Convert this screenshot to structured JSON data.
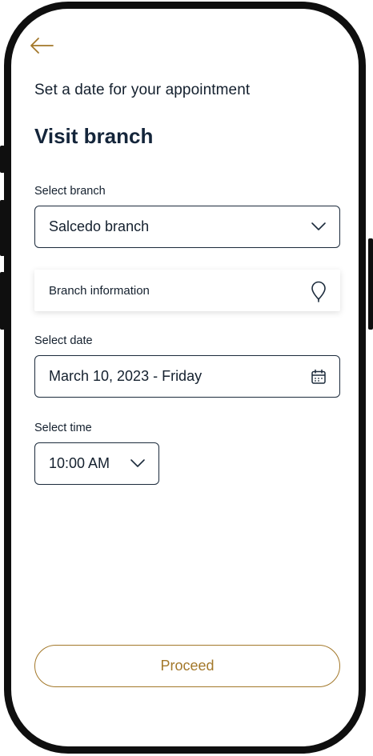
{
  "header": {
    "back_icon": "arrow-left-icon",
    "subtitle": "Set a date for your appointment",
    "title": "Visit branch"
  },
  "branch": {
    "label": "Select branch",
    "value": "Salcedo branch",
    "icon": "chevron-down-icon"
  },
  "branch_info": {
    "label": "Branch information",
    "icon": "map-pin-icon"
  },
  "date": {
    "label": "Select date",
    "value": "March 10, 2023 - Friday",
    "icon": "calendar-icon"
  },
  "time": {
    "label": "Select time",
    "value": "10:00 AM",
    "icon": "chevron-down-icon"
  },
  "actions": {
    "proceed_label": "Proceed"
  },
  "colors": {
    "accent": "#a3782a",
    "text_dark": "#14253a",
    "border": "#1c2b3c",
    "frame": "#0f0f0f"
  }
}
